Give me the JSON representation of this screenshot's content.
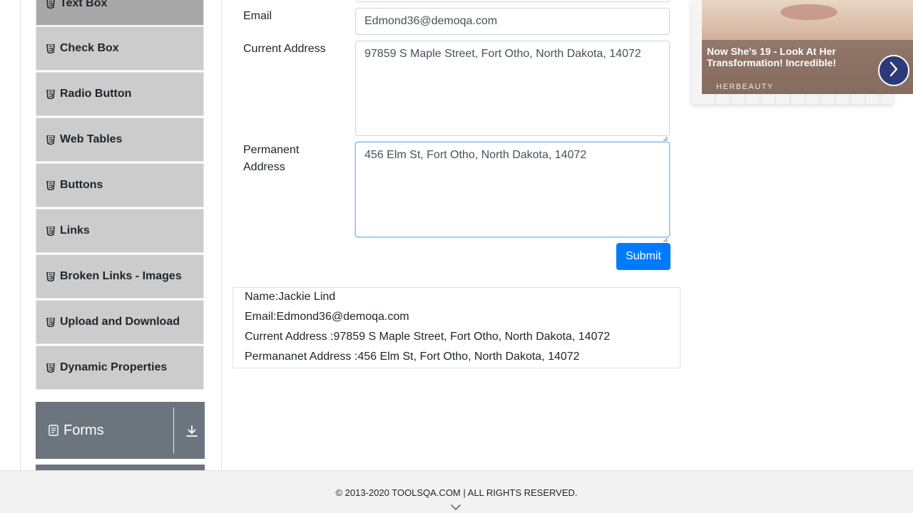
{
  "sidebar": {
    "items": [
      {
        "label": "Text Box",
        "active": true
      },
      {
        "label": "Check Box"
      },
      {
        "label": "Radio Button"
      },
      {
        "label": "Web Tables"
      },
      {
        "label": "Buttons"
      },
      {
        "label": "Links"
      },
      {
        "label": "Broken Links - Images"
      },
      {
        "label": "Upload and Download"
      },
      {
        "label": "Dynamic Properties"
      }
    ],
    "group": {
      "label": "Forms",
      "icon": "form-icon",
      "toggle_icon": "download-arrow-icon"
    }
  },
  "form": {
    "email": {
      "label": "Email",
      "value": "Edmond36@demoqa.com"
    },
    "current_address": {
      "label": "Current Address",
      "value": "97859 S Maple Street, Fort Otho, North Dakota, 14072"
    },
    "permanent_address": {
      "label_line1": "Permanent",
      "label_line2": "Address",
      "value": "456 Elm St, Fort Otho, North Dakota, 14072"
    },
    "submit_label": "Submit"
  },
  "output": {
    "name": "Name:Jackie Lind",
    "email": "Email:Edmond36@demoqa.com",
    "current_address": "Current Address :97859 S Maple Street, Fort Otho, North Dakota, 14072",
    "permanent_address": "Permananet Address :456 Elm St, Fort Otho, North Dakota, 14072"
  },
  "ad": {
    "title": "Now She's 19 - Look At Her Transformation! Incredible!",
    "brand": "HERBEAUTY"
  },
  "footer": {
    "text": "© 2013-2020 TOOLSQA.COM | ALL RIGHTS RESERVED."
  },
  "colors": {
    "primary": "#007bff",
    "sidebar_item": "#cccccc",
    "sidebar_active": "#a8a8a8",
    "group_header": "#6c757d"
  }
}
